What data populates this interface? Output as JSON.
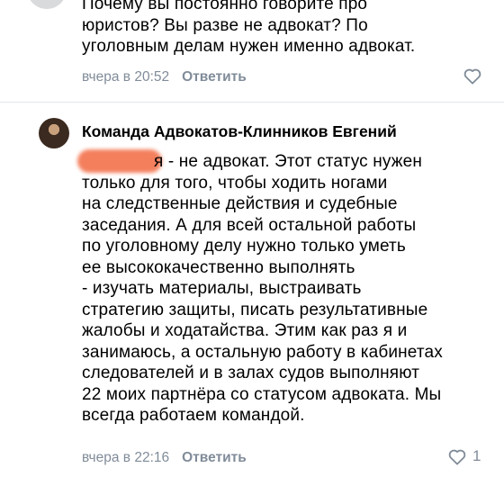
{
  "previous_comment": {
    "lines": [
      "Почему вы постоянно говорите про",
      "юристов? Вы разве не адвокат? По",
      "уголовным делам нужен именно адвокат."
    ],
    "time": "вчера в 20:52",
    "reply_label": "Ответить"
  },
  "reply_comment": {
    "author": "Команда Адвокатов-Клинников Евгений",
    "lines": [
      "я - не адвокат. Этот статус нужен",
      "только для того, чтобы ходить ногами",
      "на следственные действия и судебные",
      "заседания. А для всей остальной работы",
      "по уголовному делу нужно только уметь",
      "ее высококачественно выполнять",
      "- изучать материалы, выстраивать",
      "стратегию защиты, писать результативные",
      "жалобы и ходатайства. Этим как раз я и",
      "занимаюсь, а остальную работу в кабинетах",
      "следователей и в залах судов выполняют",
      "22 моих партнёра со статусом адвоката. Мы",
      "всегда работаем командой."
    ],
    "time": "вчера в 22:16",
    "reply_label": "Ответить",
    "like_count": "1"
  },
  "colors": {
    "meta_text": "#818c99",
    "redaction": "#f47f5d"
  }
}
